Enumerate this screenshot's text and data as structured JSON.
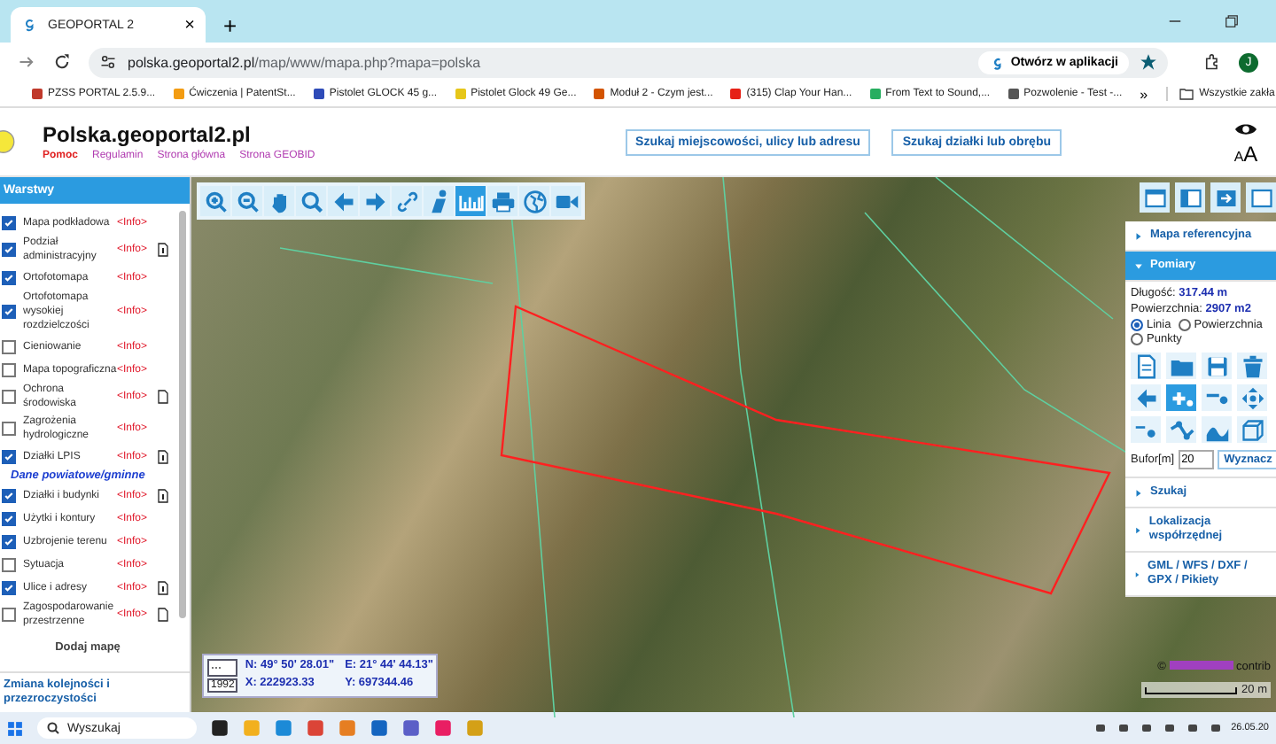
{
  "browser": {
    "tab": {
      "title": "GEOPORTAL 2",
      "close": "×"
    },
    "new_tab": "+",
    "url_domain": "polska.geoportal2.pl",
    "url_path": "/map/www/mapa.php?mapa=polska",
    "open_in_app": "Otwórz w aplikacji",
    "profile": "J",
    "bookmarks": [
      {
        "label": "PZSS PORTAL 2.5.9...",
        "color": "#c0392b"
      },
      {
        "label": "Ćwiczenia | PatentSt...",
        "color": "#f39c12"
      },
      {
        "label": "Pistolet GLOCK 45 g...",
        "color": "#2e4bb8"
      },
      {
        "label": "Pistolet Glock 49 Ge...",
        "color": "#e6c619"
      },
      {
        "label": "Moduł 2 - Czym jest...",
        "color": "#d35400"
      },
      {
        "label": "(315) Clap Your Han...",
        "color": "#e62117"
      },
      {
        "label": "From Text to Sound,...",
        "color": "#27ae60"
      },
      {
        "label": "Pozwolenie - Test -...",
        "color": "#555555"
      }
    ],
    "more": "»",
    "all_bookmarks": "Wszystkie zakła"
  },
  "site": {
    "title": "Polska.geoportal2.pl",
    "links": [
      {
        "label": "Pomoc",
        "selected": true
      },
      {
        "label": "Regulamin",
        "selected": false
      },
      {
        "label": "Strona główna",
        "selected": false
      },
      {
        "label": "Strona GEOBID",
        "selected": false
      }
    ],
    "search_buttons": [
      "Szukaj miejscowości, ulicy lub adresu",
      "Szukaj działki lub obrębu"
    ],
    "font_small": "A",
    "font_large": "A"
  },
  "layers_panel": {
    "title": "Warstwy",
    "items": [
      {
        "kind": "layer",
        "label": "Mapa podkładowa",
        "checked": true,
        "info": "<Info>"
      },
      {
        "kind": "layer-legend",
        "label": "Podział administracyjny",
        "checked": true,
        "info": "<Info>"
      },
      {
        "kind": "layer",
        "label": "Ortofotomapa",
        "checked": true,
        "info": "<Info>"
      },
      {
        "kind": "layer",
        "label": "Ortofotomapa wysokiej rozdzielczości",
        "checked": true,
        "info": "<Info>"
      },
      {
        "kind": "layer",
        "label": "Cieniowanie",
        "checked": false,
        "info": "<Info>"
      },
      {
        "kind": "layer",
        "label": "Mapa topograficzna",
        "checked": false,
        "info": "<Info>"
      },
      {
        "kind": "layer-doc",
        "label": "Ochrona środowiska",
        "checked": false,
        "info": "<Info>"
      },
      {
        "kind": "layer",
        "label": "Zagrożenia hydrologiczne",
        "checked": false,
        "info": "<Info>"
      },
      {
        "kind": "layer-legend",
        "label": "Działki LPIS",
        "checked": true,
        "info": "<Info>"
      },
      {
        "kind": "group",
        "label": "Dane powiatowe/gminne"
      },
      {
        "kind": "layer-legend",
        "label": "Działki i budynki",
        "checked": true,
        "info": "<Info>"
      },
      {
        "kind": "layer",
        "label": "Użytki i kontury",
        "checked": true,
        "info": "<Info>"
      },
      {
        "kind": "layer",
        "label": "Uzbrojenie terenu",
        "checked": true,
        "info": "<Info>"
      },
      {
        "kind": "layer",
        "label": "Sytuacja",
        "checked": false,
        "info": "<Info>"
      },
      {
        "kind": "layer-legend",
        "label": "Ulice i adresy",
        "checked": true,
        "info": "<Info>"
      },
      {
        "kind": "layer-doc",
        "label": "Zagospodarowanie przestrzenne",
        "checked": false,
        "info": "<Info>"
      }
    ],
    "add_map": "Dodaj mapę",
    "reorder_link": "Zmiana kolejności i przezroczystości"
  },
  "map_toolbar": [
    {
      "kind": "zoom-in",
      "selected": false
    },
    {
      "kind": "zoom-out",
      "selected": false
    },
    {
      "kind": "pan",
      "selected": false
    },
    {
      "kind": "zoom-box",
      "selected": false
    },
    {
      "kind": "back",
      "selected": false
    },
    {
      "kind": "forward",
      "selected": false
    },
    {
      "kind": "link",
      "selected": false
    },
    {
      "kind": "info",
      "selected": false
    },
    {
      "kind": "measure",
      "selected": true
    },
    {
      "kind": "print",
      "selected": false
    },
    {
      "kind": "globe",
      "selected": false
    },
    {
      "kind": "video",
      "selected": false
    }
  ],
  "coordinates": {
    "menu": "⋯",
    "system": "1992",
    "n": "N: 49° 50' 28.01\"",
    "e": "E: 21° 44' 44.13\"",
    "x": "X: 222923.33",
    "y": "Y: 697344.46"
  },
  "scale": "20 m",
  "attribution": {
    "prefix": "©",
    "text": "contrib"
  },
  "tools_panel": {
    "sections": [
      {
        "kind": "collapsed",
        "title": "Mapa referencyjna"
      },
      {
        "kind": "measure",
        "title": "Pomiary",
        "length_label": "Długość:",
        "length": "317.44 m",
        "area_label": "Powierzchnia:",
        "area": "2907 m2",
        "modes": [
          {
            "label": "Linia",
            "selected": true
          },
          {
            "label": "Powierzchnia",
            "selected": false
          },
          {
            "label": "Punkty",
            "selected": false
          }
        ],
        "tools": [
          {
            "kind": "new",
            "selected": false
          },
          {
            "kind": "open",
            "selected": false
          },
          {
            "kind": "save",
            "selected": false
          },
          {
            "kind": "delete",
            "selected": false
          },
          {
            "kind": "back",
            "selected": false
          },
          {
            "kind": "add-point",
            "selected": true
          },
          {
            "kind": "line-point",
            "selected": false
          },
          {
            "kind": "move",
            "selected": false
          },
          {
            "kind": "angle",
            "selected": false
          },
          {
            "kind": "polyline",
            "selected": false
          },
          {
            "kind": "curve",
            "selected": false
          },
          {
            "kind": "box",
            "selected": false
          }
        ],
        "buffer_label": "Bufor[m]",
        "buffer": "20",
        "compute": "Wyznacz"
      },
      {
        "kind": "collapsed",
        "title": "Szukaj"
      },
      {
        "kind": "collapsed",
        "title": "Lokalizacja współrzędnej"
      },
      {
        "kind": "collapsed",
        "title": "GML / WFS / DXF / GPX / Pikiety"
      }
    ]
  },
  "taskbar": {
    "search": "Wyszukaj",
    "date": "26.05.20"
  }
}
